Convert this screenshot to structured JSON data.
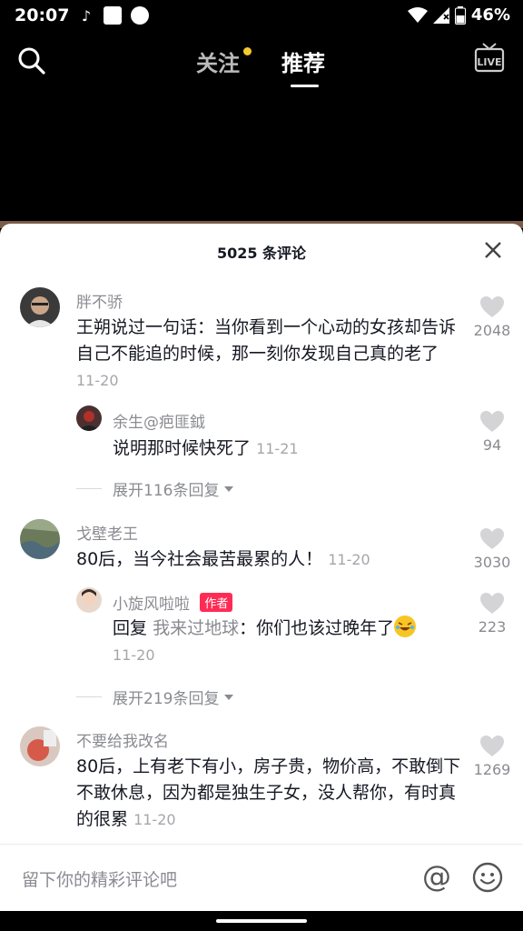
{
  "status": {
    "time": "20:07",
    "battery": "46%"
  },
  "nav": {
    "follow": "关注",
    "recommend": "推荐"
  },
  "sheet": {
    "title": "5025 条评论"
  },
  "comments": [
    {
      "user": "胖不骄",
      "text": "王朔说过一句话：当你看到一个心动的女孩却告诉自己不能追的时候，那一刻你发现自己真的老了",
      "date": "11-20",
      "likes": "2048"
    },
    {
      "user": "余生@疤匪鉞",
      "text": "说明那时候快死了",
      "date": "11-21",
      "likes": "94"
    },
    {
      "user": "戈壁老王",
      "text": "80后，当今社会最苦最累的人！",
      "date": "11-20",
      "likes": "3030"
    },
    {
      "user": "小旋风啦啦",
      "badge": "作者",
      "reply_prefix": "回复",
      "reply_target": "我来过地球",
      "text": "：你们也该过晚年了",
      "date": "11-20",
      "likes": "223"
    },
    {
      "user": "不要给我改名",
      "text": "80后，上有老下有小，房子贵，物价高，不敢倒下不敢休息，因为都是独生子女，没人帮你，有时真的很累",
      "date": "11-20",
      "likes": "1269"
    }
  ],
  "expand": [
    "展开116条回复",
    "展开219条回复"
  ],
  "input": {
    "placeholder": "留下你的精彩评论吧"
  },
  "colors": {
    "accent": "#fe2c55",
    "dot": "#f7c731"
  }
}
